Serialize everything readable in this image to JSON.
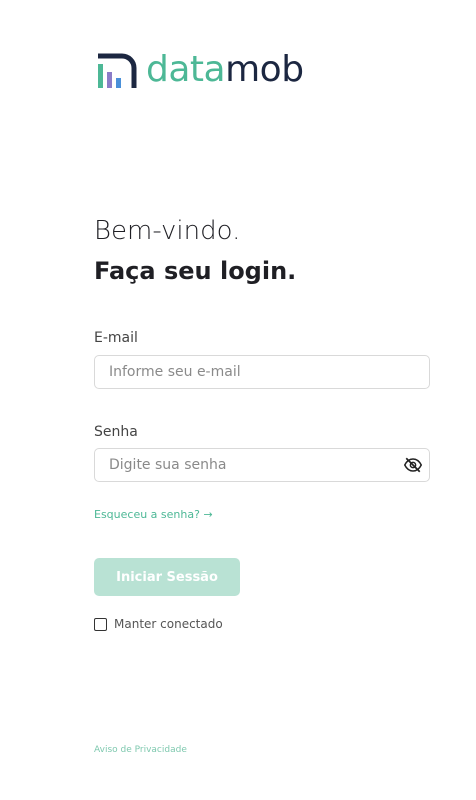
{
  "brand": {
    "logo_icon": "datamob-bars-icon",
    "name_part1": "data",
    "name_part2": "mob",
    "primary_color": "#4db896",
    "dark_color": "#1c2741"
  },
  "heading": {
    "welcome": "Bem-vindo.",
    "title": "Faça seu login."
  },
  "form": {
    "email_label": "E-mail",
    "email_placeholder": "Informe seu e-mail",
    "email_value": "",
    "password_label": "Senha",
    "password_placeholder": "Digite sua senha",
    "password_value": "",
    "toggle_password_icon": "eye-off-icon",
    "forgot_link": "Esqueceu a senha?",
    "forgot_icon": "arrow-right-icon",
    "submit_label": "Iniciar Sessão",
    "submit_color": "#b9e2d4",
    "keep_logged_label": "Manter conectado",
    "keep_logged_checked": false
  },
  "footer": {
    "privacy_link": "Aviso de Privacidade"
  }
}
